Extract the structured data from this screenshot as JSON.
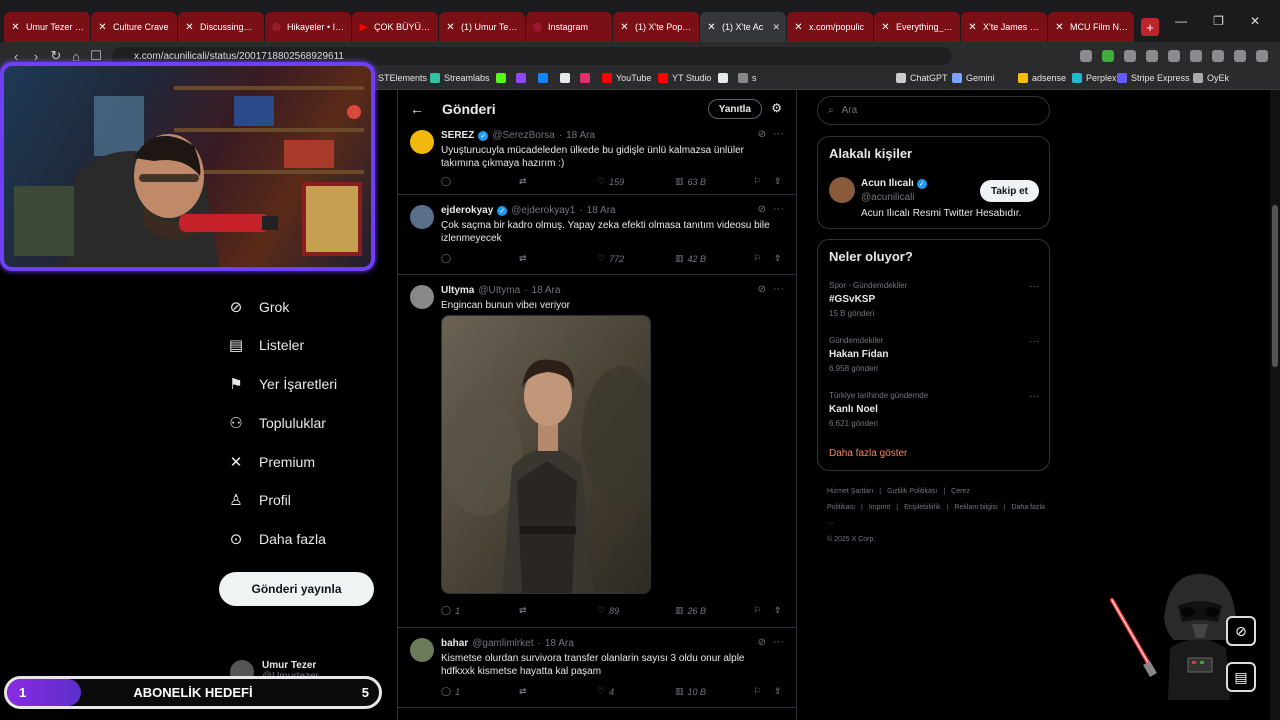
{
  "browser": {
    "tabs": [
      {
        "title": "Umur Tezer (@",
        "icon": "x-icon",
        "active": false
      },
      {
        "title": "Culture Crave",
        "icon": "x-icon",
        "active": false
      },
      {
        "title": "DiscussingFilm",
        "icon": "x-icon",
        "active": false
      },
      {
        "title": "Hikayeler • Inst",
        "icon": "instagram-icon",
        "active": false
      },
      {
        "title": "ÇOK BÜYÜK SP",
        "icon": "youtube-icon",
        "active": false
      },
      {
        "title": "(1) Umur Tezer",
        "icon": "x-icon",
        "active": false
      },
      {
        "title": "Instagram",
        "icon": "instagram-icon",
        "active": false
      },
      {
        "title": "(1) X'te Popula",
        "icon": "x-icon",
        "active": false
      },
      {
        "title": "(1) X'te Ac",
        "icon": "x-icon",
        "active": true
      },
      {
        "title": "x.com/populic",
        "icon": "x-icon",
        "active": false
      },
      {
        "title": "Everything_DC",
        "icon": "x-icon",
        "active": false
      },
      {
        "title": "X'te James Gun",
        "icon": "x-icon",
        "active": false
      },
      {
        "title": "MCU Film New",
        "icon": "x-icon",
        "active": false
      }
    ],
    "new_tab": "+",
    "url": "x.com/acunilicali/status/2001718802568929611",
    "bookmarks": [
      {
        "label": "STElements",
        "color": "#3a6fd8"
      },
      {
        "label": "Streamlabs",
        "color": "#31c3a2"
      },
      {
        "label": "",
        "color": "#53fc18"
      },
      {
        "label": "",
        "color": "#9146ff"
      },
      {
        "label": "",
        "color": "#1185fe"
      },
      {
        "label": "",
        "color": "#e7e9ea"
      },
      {
        "label": "",
        "color": "#e1306c"
      },
      {
        "label": "YouTube",
        "color": "#ff0000"
      },
      {
        "label": "YT Studio",
        "color": "#ff0000"
      },
      {
        "label": "",
        "color": "#e7e9ea"
      },
      {
        "label": "s",
        "color": "#888888"
      },
      {
        "label": "ChatGPT",
        "color": "#cccccc"
      },
      {
        "label": "Gemini",
        "color": "#7aa2ff"
      },
      {
        "label": "adsense",
        "color": "#fbbc04"
      },
      {
        "label": "Perplexity",
        "color": "#20b8cd"
      },
      {
        "label": "Stripe Express",
        "color": "#635bff"
      },
      {
        "label": "OyEk",
        "color": "#aaaaaa"
      }
    ]
  },
  "nav": {
    "items": [
      {
        "label": "Grok",
        "icon": "grok-icon"
      },
      {
        "label": "Listeler",
        "icon": "list-icon"
      },
      {
        "label": "Yer İşaretleri",
        "icon": "bookmark-icon"
      },
      {
        "label": "Topluluklar",
        "icon": "communities-icon"
      },
      {
        "label": "Premium",
        "icon": "x-icon"
      },
      {
        "label": "Profil",
        "icon": "profile-icon"
      },
      {
        "label": "Daha fazla",
        "icon": "more-icon"
      }
    ],
    "post_button": "Gönderi yayınla",
    "account": {
      "name": "Umur Tezer",
      "handle": "@Umurtezer"
    }
  },
  "header": {
    "title": "Gönderi",
    "reply_button": "Yanıtla"
  },
  "tweets": [
    {
      "name": "SEREZ",
      "verified": true,
      "handle": "@SerezBorsa",
      "date": "18 Ara",
      "text": "Uyuşturucuyla mücadeleden ülkede bu gidişle ünlü kalmazsa ünlüler takımına çıkmaya hazırım :)",
      "replies": "",
      "reposts": "",
      "likes": "159",
      "views": "63 B",
      "avatar_color": "#f0b90b"
    },
    {
      "name": "ejderokyay",
      "verified": true,
      "handle": "@ejderokyay1",
      "date": "18 Ara",
      "text": "Çok saçma bir kadro olmuş. Yapay zeka efekti olmasa tanıtım videosu bile izlenmeyecek",
      "replies": "",
      "reposts": "",
      "likes": "772",
      "views": "42 B",
      "avatar_color": "#5a6f8a"
    },
    {
      "name": "Ultyma",
      "verified": false,
      "handle": "@UItyma",
      "date": "18 Ara",
      "text": "Engincan bunun vibeı veriyor",
      "replies": "1",
      "reposts": "",
      "likes": "89",
      "views": "26 B",
      "avatar_color": "#888888"
    },
    {
      "name": "bahar",
      "verified": false,
      "handle": "@gamlimlrket",
      "date": "18 Ara",
      "text": "Kismetse olurdan survivora transfer olanlarin sayısı 3 oldu onur alple hdfkxxk kismetse hayatta kal paşam",
      "replies": "1",
      "reposts": "",
      "likes": "4",
      "views": "10 B",
      "avatar_color": "#6b7b5a"
    }
  ],
  "search": {
    "placeholder": "Ara"
  },
  "related": {
    "title": "Alakalı kişiler",
    "name": "Acun Ilıcalı",
    "handle": "@acunilicali",
    "bio": "Acun Ilıcalı Resmi Twitter Hesabıdır.",
    "follow_button": "Takip et"
  },
  "trends": {
    "title": "Neler oluyor?",
    "items": [
      {
        "context": "Spor · Gündemdekiler",
        "name": "#GSvKSP",
        "count": "15 B gönderi"
      },
      {
        "context": "Gündemdekiler",
        "name": "Hakan Fidan",
        "count": "6.958 gönderi"
      },
      {
        "context": "Türkiye tarihinde gündemde",
        "name": "Kanlı Noel",
        "count": "6.621 gönderi"
      }
    ],
    "show_more": "Daha fazla göster"
  },
  "footer": {
    "links": [
      "Hizmet Şartları",
      "|",
      "Gizlilik Politikası",
      "|",
      "Çerez Politikası",
      "|",
      "Imprint",
      "|",
      "Erişilebilirlik",
      "|",
      "Reklam bilgisi",
      "|",
      "Daha fazla ···"
    ],
    "copyright": "© 2025 X Corp."
  },
  "overlay": {
    "goal_label": "ABONELİK HEDEFİ",
    "goal_current": "1",
    "goal_target": "5",
    "goal_fill_fraction": 0.2
  },
  "colors": {
    "accent": "#1d9bf0",
    "webcam_border": "#6f3ff6",
    "tab_red": "#7a1016"
  }
}
